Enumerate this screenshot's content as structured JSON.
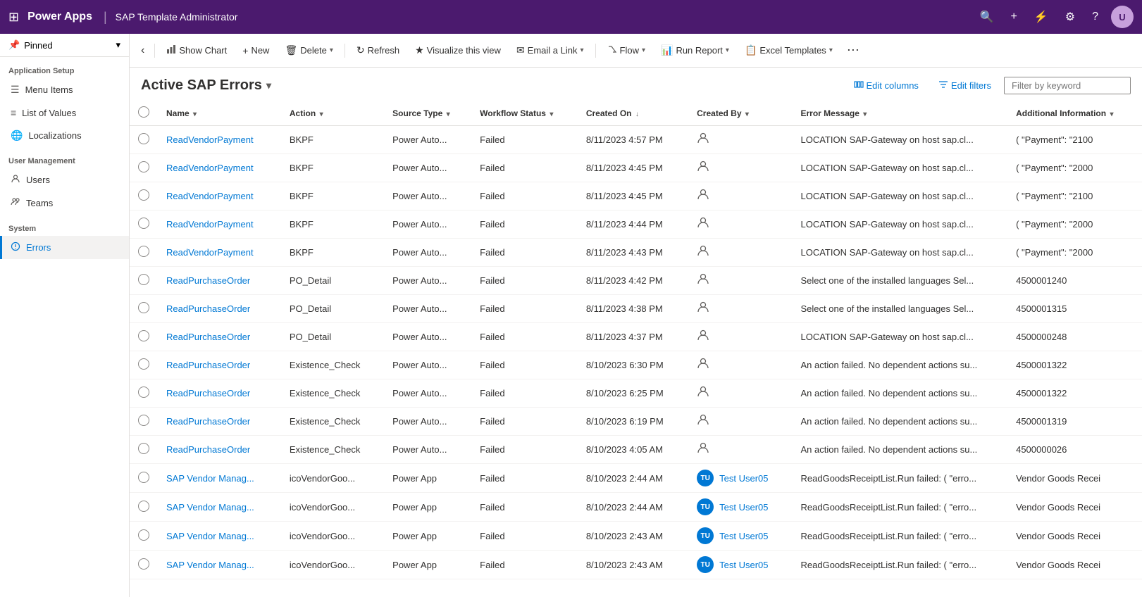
{
  "topNav": {
    "logoText": "Power Apps",
    "separator": "|",
    "appTitle": "SAP Template Administrator",
    "avatarInitials": "U"
  },
  "sidebar": {
    "pinnedLabel": "Pinned",
    "collapseIcon": "▾",
    "sections": [
      {
        "label": "Application Setup",
        "items": [
          {
            "id": "menu-items",
            "icon": "☰",
            "label": "Menu Items",
            "active": false
          },
          {
            "id": "list-of-values",
            "icon": "≡",
            "label": "List of Values",
            "active": false
          },
          {
            "id": "localizations",
            "icon": "🌐",
            "label": "Localizations",
            "active": false
          }
        ]
      },
      {
        "label": "User Management",
        "items": [
          {
            "id": "users",
            "icon": "👤",
            "label": "Users",
            "active": false
          },
          {
            "id": "teams",
            "icon": "👥",
            "label": "Teams",
            "active": false
          }
        ]
      },
      {
        "label": "System",
        "items": [
          {
            "id": "errors",
            "icon": "⚠",
            "label": "Errors",
            "active": true
          }
        ]
      }
    ]
  },
  "toolbar": {
    "backButton": "‹",
    "showChartLabel": "Show Chart",
    "newLabel": "New",
    "deleteLabel": "Delete",
    "refreshLabel": "Refresh",
    "visualizeLabel": "Visualize this view",
    "emailLinkLabel": "Email a Link",
    "flowLabel": "Flow",
    "runReportLabel": "Run Report",
    "excelTemplatesLabel": "Excel Templates"
  },
  "viewHeader": {
    "title": "Active SAP Errors",
    "editColumnsLabel": "Edit columns",
    "editFiltersLabel": "Edit filters",
    "filterPlaceholder": "Filter by keyword"
  },
  "table": {
    "columns": [
      {
        "id": "name",
        "label": "Name"
      },
      {
        "id": "action",
        "label": "Action"
      },
      {
        "id": "sourceType",
        "label": "Source Type"
      },
      {
        "id": "workflowStatus",
        "label": "Workflow Status"
      },
      {
        "id": "createdOn",
        "label": "Created On"
      },
      {
        "id": "createdBy",
        "label": "Created By"
      },
      {
        "id": "errorMessage",
        "label": "Error Message"
      },
      {
        "id": "additionalInfo",
        "label": "Additional Information"
      }
    ],
    "rows": [
      {
        "name": "ReadVendorPayment",
        "action": "BKPF",
        "sourceType": "Power Auto...",
        "workflowStatus": "Failed",
        "createdOn": "8/11/2023 4:57 PM",
        "createdBy": "",
        "createdByAvatar": false,
        "errorMessage": "LOCATION  SAP-Gateway on host sap.cl...",
        "additionalInfo": "(  \"Payment\": \"2100"
      },
      {
        "name": "ReadVendorPayment",
        "action": "BKPF",
        "sourceType": "Power Auto...",
        "workflowStatus": "Failed",
        "createdOn": "8/11/2023 4:45 PM",
        "createdBy": "",
        "createdByAvatar": false,
        "errorMessage": "LOCATION  SAP-Gateway on host sap.cl...",
        "additionalInfo": "(  \"Payment\": \"2000"
      },
      {
        "name": "ReadVendorPayment",
        "action": "BKPF",
        "sourceType": "Power Auto...",
        "workflowStatus": "Failed",
        "createdOn": "8/11/2023 4:45 PM",
        "createdBy": "",
        "createdByAvatar": false,
        "errorMessage": "LOCATION  SAP-Gateway on host sap.cl...",
        "additionalInfo": "(  \"Payment\": \"2100"
      },
      {
        "name": "ReadVendorPayment",
        "action": "BKPF",
        "sourceType": "Power Auto...",
        "workflowStatus": "Failed",
        "createdOn": "8/11/2023 4:44 PM",
        "createdBy": "",
        "createdByAvatar": false,
        "errorMessage": "LOCATION  SAP-Gateway on host sap.cl...",
        "additionalInfo": "(  \"Payment\": \"2000"
      },
      {
        "name": "ReadVendorPayment",
        "action": "BKPF",
        "sourceType": "Power Auto...",
        "workflowStatus": "Failed",
        "createdOn": "8/11/2023 4:43 PM",
        "createdBy": "",
        "createdByAvatar": false,
        "errorMessage": "LOCATION  SAP-Gateway on host sap.cl...",
        "additionalInfo": "(  \"Payment\": \"2000"
      },
      {
        "name": "ReadPurchaseOrder",
        "action": "PO_Detail",
        "sourceType": "Power Auto...",
        "workflowStatus": "Failed",
        "createdOn": "8/11/2023 4:42 PM",
        "createdBy": "",
        "createdByAvatar": false,
        "errorMessage": "Select one of the installed languages  Sel...",
        "additionalInfo": "4500001240"
      },
      {
        "name": "ReadPurchaseOrder",
        "action": "PO_Detail",
        "sourceType": "Power Auto...",
        "workflowStatus": "Failed",
        "createdOn": "8/11/2023 4:38 PM",
        "createdBy": "",
        "createdByAvatar": false,
        "errorMessage": "Select one of the installed languages  Sel...",
        "additionalInfo": "4500001315"
      },
      {
        "name": "ReadPurchaseOrder",
        "action": "PO_Detail",
        "sourceType": "Power Auto...",
        "workflowStatus": "Failed",
        "createdOn": "8/11/2023 4:37 PM",
        "createdBy": "",
        "createdByAvatar": false,
        "errorMessage": "LOCATION  SAP-Gateway on host sap.cl...",
        "additionalInfo": "4500000248"
      },
      {
        "name": "ReadPurchaseOrder",
        "action": "Existence_Check",
        "sourceType": "Power Auto...",
        "workflowStatus": "Failed",
        "createdOn": "8/10/2023 6:30 PM",
        "createdBy": "",
        "createdByAvatar": false,
        "errorMessage": "An action failed. No dependent actions su...",
        "additionalInfo": "4500001322"
      },
      {
        "name": "ReadPurchaseOrder",
        "action": "Existence_Check",
        "sourceType": "Power Auto...",
        "workflowStatus": "Failed",
        "createdOn": "8/10/2023 6:25 PM",
        "createdBy": "",
        "createdByAvatar": false,
        "errorMessage": "An action failed. No dependent actions su...",
        "additionalInfo": "4500001322"
      },
      {
        "name": "ReadPurchaseOrder",
        "action": "Existence_Check",
        "sourceType": "Power Auto...",
        "workflowStatus": "Failed",
        "createdOn": "8/10/2023 6:19 PM",
        "createdBy": "",
        "createdByAvatar": false,
        "errorMessage": "An action failed. No dependent actions su...",
        "additionalInfo": "4500001319"
      },
      {
        "name": "ReadPurchaseOrder",
        "action": "Existence_Check",
        "sourceType": "Power Auto...",
        "workflowStatus": "Failed",
        "createdOn": "8/10/2023 4:05 AM",
        "createdBy": "",
        "createdByAvatar": false,
        "errorMessage": "An action failed. No dependent actions su...",
        "additionalInfo": "4500000026"
      },
      {
        "name": "SAP Vendor Manag...",
        "action": "icoVendorGoo...",
        "sourceType": "Power App",
        "workflowStatus": "Failed",
        "createdOn": "8/10/2023 2:44 AM",
        "createdBy": "Test User05",
        "createdByAvatar": true,
        "avatarInitials": "TU",
        "avatarColor": "#0078d4",
        "errorMessage": "ReadGoodsReceiptList.Run failed: (  \"erro...",
        "additionalInfo": "Vendor Goods Recei"
      },
      {
        "name": "SAP Vendor Manag...",
        "action": "icoVendorGoo...",
        "sourceType": "Power App",
        "workflowStatus": "Failed",
        "createdOn": "8/10/2023 2:44 AM",
        "createdBy": "Test User05",
        "createdByAvatar": true,
        "avatarInitials": "TU",
        "avatarColor": "#0078d4",
        "errorMessage": "ReadGoodsReceiptList.Run failed: (  \"erro...",
        "additionalInfo": "Vendor Goods Recei"
      },
      {
        "name": "SAP Vendor Manag...",
        "action": "icoVendorGoo...",
        "sourceType": "Power App",
        "workflowStatus": "Failed",
        "createdOn": "8/10/2023 2:43 AM",
        "createdBy": "Test User05",
        "createdByAvatar": true,
        "avatarInitials": "TU",
        "avatarColor": "#0078d4",
        "errorMessage": "ReadGoodsReceiptList.Run failed: (  \"erro...",
        "additionalInfo": "Vendor Goods Recei"
      },
      {
        "name": "SAP Vendor Manag...",
        "action": "icoVendorGoo...",
        "sourceType": "Power App",
        "workflowStatus": "Failed",
        "createdOn": "8/10/2023 2:43 AM",
        "createdBy": "Test User05",
        "createdByAvatar": true,
        "avatarInitials": "TU",
        "avatarColor": "#0078d4",
        "errorMessage": "ReadGoodsReceiptList.Run failed: (  \"erro...",
        "additionalInfo": "Vendor Goods Recei"
      }
    ]
  }
}
